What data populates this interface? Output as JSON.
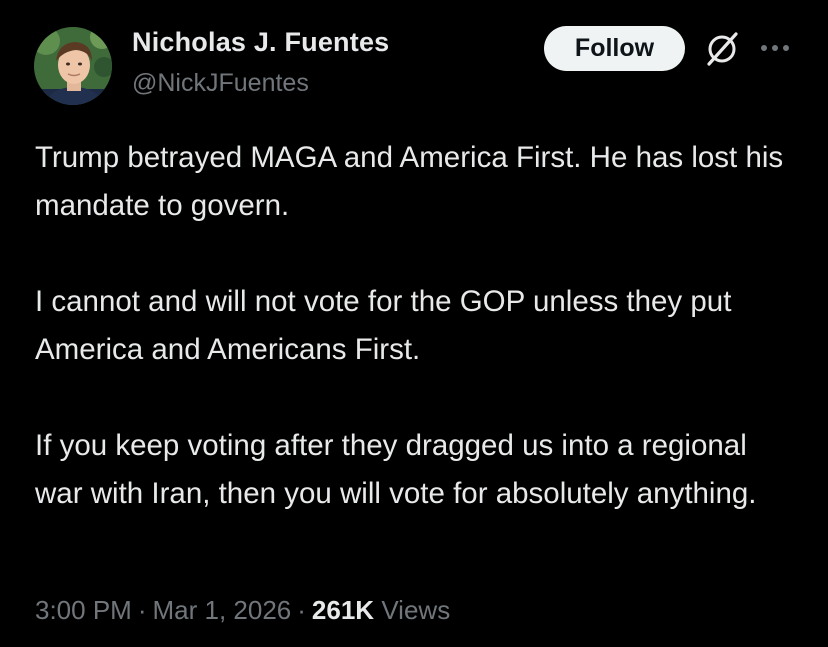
{
  "author": {
    "display_name": "Nicholas J. Fuentes",
    "handle": "@NickJFuentes"
  },
  "actions": {
    "follow_label": "Follow",
    "grok_icon": "grok-icon",
    "more_icon": "more-options-icon"
  },
  "post": {
    "paragraphs": [
      "Trump betrayed MAGA and America First. He has lost his mandate to govern.",
      "I cannot and will not vote for the GOP unless they put America and Americans First.",
      "If you keep voting after they dragged us into a regional war with Iran, then you will vote for absolutely anything."
    ]
  },
  "meta": {
    "time": "3:00 PM",
    "separator": "·",
    "date": "Mar 1, 2026",
    "views_count": "261K",
    "views_label": "Views"
  },
  "colors": {
    "background": "#000000",
    "primary_text": "#e7e9ea",
    "secondary_text": "#71767b",
    "follow_bg": "#eff3f4",
    "follow_text": "#0f1419"
  }
}
